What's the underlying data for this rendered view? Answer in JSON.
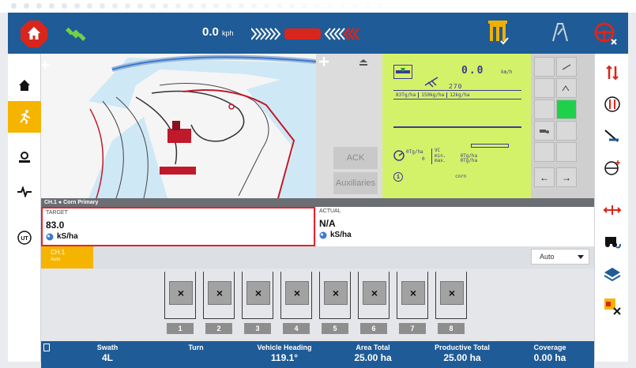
{
  "topbar": {
    "speed_value": "0.0",
    "speed_unit": "kph"
  },
  "leftbar": {
    "items": [
      "home",
      "guidance",
      "implement",
      "diagnostics",
      "ut"
    ]
  },
  "midpanel": {
    "ack_label": "ACK",
    "auxiliaries_label": "Auxiliaries"
  },
  "lcd": {
    "speed": "0.0",
    "speed_unit": "km/h",
    "heading": "270",
    "rates": [
      "83Tg/ha",
      "150kg/ha",
      "12kg/ha"
    ],
    "pressure_label": "0Tg/ha",
    "pressure_value": "0",
    "vc_label": "VC",
    "min_label": "min.",
    "max_label": "max.",
    "min_value": "0Tg/ha",
    "max_value": "0Tg/ha",
    "crop": "corn",
    "info": "i"
  },
  "channel": {
    "header": "CH.1  ●  Corn Primary",
    "target_label": "TARGET",
    "target_value": "83.0",
    "target_unit": "kS/ha",
    "actual_label": "ACTUAL",
    "actual_value": "N/A",
    "actual_unit": "kS/ha",
    "tab_name": "CH.1",
    "tab_mode": "Auto",
    "dropdown_value": "Auto"
  },
  "sections": [
    "1",
    "2",
    "3",
    "4",
    "5",
    "6",
    "7",
    "8"
  ],
  "stats": [
    {
      "label": "Swath",
      "value": "4L"
    },
    {
      "label": "Turn",
      "value": ""
    },
    {
      "label": "Vehicle Heading",
      "value": "119.1°"
    },
    {
      "label": "Area Total",
      "value": "25.00 ha"
    },
    {
      "label": "Productive Total",
      "value": "25.00 ha"
    },
    {
      "label": "Coverage",
      "value": "0.00 ha"
    }
  ],
  "colors": {
    "brand_blue": "#1f5b96",
    "accent_yellow": "#f5b400",
    "alert_red": "#e2232c",
    "lcd_green": "#d4f269"
  }
}
